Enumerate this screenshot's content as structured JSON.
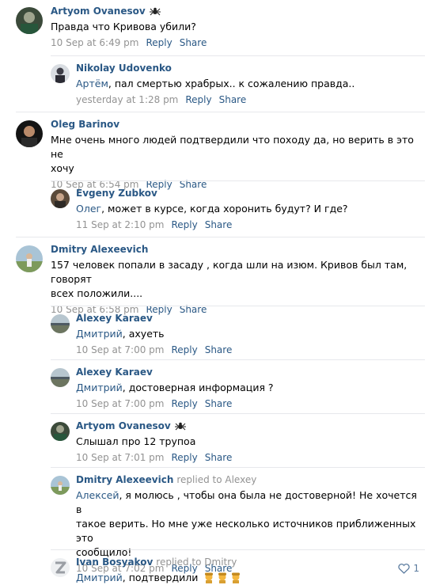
{
  "comments": [
    {
      "author": "Artyom Ovanesov",
      "text": "Правда что Кривова убили?",
      "time": "10 Sep at 6:49 pm",
      "reply": "Reply",
      "share": "Share"
    },
    {
      "author": "Nikolay Udovenko",
      "mention": "Артём",
      "text": ", пал смертью храбрых.. к сожалению правда..",
      "time": "yesterday at 1:28 pm",
      "reply": "Reply",
      "share": "Share"
    },
    {
      "author": "Oleg Barinov",
      "text_line1": "Мне очень много людей подтвердили что походу да, но верить в это не",
      "text_line2": "хочу",
      "time": "10 Sep at 6:54 pm",
      "reply": "Reply",
      "share": "Share"
    },
    {
      "author": "Evgeny Zubkov",
      "mention": "Олег",
      "text": ", может в курсе, когда хоронить будут? И где?",
      "time": "11 Sep at 2:10 pm",
      "reply": "Reply",
      "share": "Share"
    },
    {
      "author": "Dmitry Alexeevich",
      "text_line1": "157 человек попали в засаду , когда шли на изюм. Кривов был там, говорят",
      "text_line2": "всех положили....",
      "time": "10 Sep at 6:58 pm",
      "reply": "Reply",
      "share": "Share"
    },
    {
      "author": "Alexey Karaev",
      "mention": "Дмитрий",
      "text": ", ахуеть",
      "time": "10 Sep at 7:00 pm",
      "reply": "Reply",
      "share": "Share"
    },
    {
      "author": "Alexey Karaev",
      "mention": "Дмитрий",
      "text": ", достоверная информация ?",
      "time": "10 Sep at 7:00 pm",
      "reply": "Reply",
      "share": "Share"
    },
    {
      "author": "Artyom Ovanesov",
      "text": "Слышал про 12 трупоа",
      "time": "10 Sep at 7:01 pm",
      "reply": "Reply",
      "share": "Share"
    },
    {
      "author": "Dmitry Alexeevich",
      "replied_to": "replied to Alexey",
      "mention": "Алексей",
      "text_line1": ", я молюсь , чтобы она была не достоверной! Не хочется в",
      "text_line2": "такое верить. Но мне уже несколько источников приближенных это",
      "text_line3": "сообщило!",
      "time": "10 Sep at 7:02 pm",
      "reply": "Reply",
      "share": "Share",
      "likes": "1"
    },
    {
      "author": "Ivan Bosyakov",
      "replied_to": "replied to Dmitry",
      "mention": "Дмитрий",
      "text": ", подтвердили"
    }
  ],
  "colors": {
    "link": "#2a5885",
    "meta": "#939393",
    "separator": "#e7e8ec"
  },
  "icons": {
    "spider": "spider-emoji-icon",
    "heart": "heart-icon",
    "salute": "saluting-soldier-emoji-icon"
  }
}
